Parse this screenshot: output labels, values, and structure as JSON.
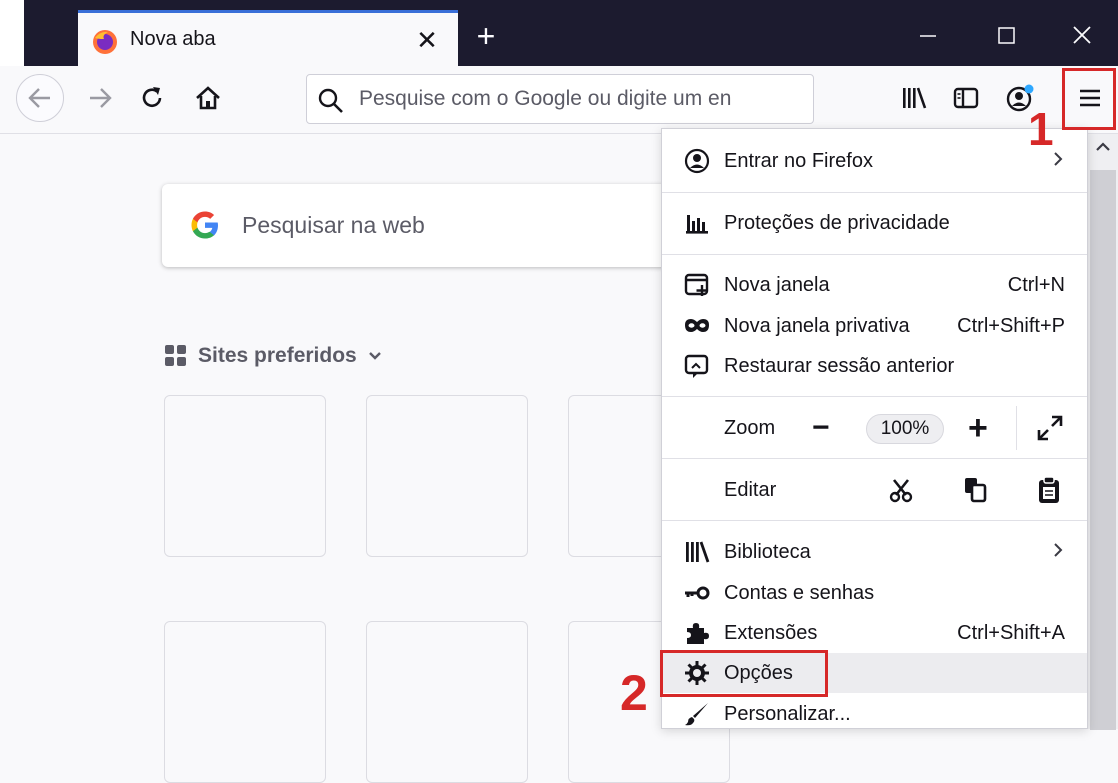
{
  "tab": {
    "title": "Nova aba"
  },
  "urlbar": {
    "placeholder": "Pesquise com o Google ou digite um en"
  },
  "content": {
    "search_placeholder": "Pesquisar na web",
    "sites_heading": "Sites preferidos"
  },
  "annotations": {
    "step1": "1",
    "step2": "2",
    "highlight_color": "#d62828"
  },
  "menu": {
    "sign_in": "Entrar no Firefox",
    "privacy": "Proteções de privacidade",
    "new_window": {
      "label": "Nova janela",
      "shortcut": "Ctrl+N"
    },
    "private_window": {
      "label": "Nova janela privativa",
      "shortcut": "Ctrl+Shift+P"
    },
    "restore": "Restaurar sessão anterior",
    "zoom": {
      "label": "Zoom",
      "value": "100%",
      "minus": "−",
      "plus": "+"
    },
    "edit": {
      "label": "Editar"
    },
    "library": "Biblioteca",
    "logins": "Contas e senhas",
    "extensions": {
      "label": "Extensões",
      "shortcut": "Ctrl+Shift+A"
    },
    "options": "Opções",
    "customize": "Personalizar..."
  },
  "colors": {
    "tabstrip": "#1c1b2f",
    "accent_tab": "#3a6fd8",
    "page_bg": "#f9f9fb"
  }
}
